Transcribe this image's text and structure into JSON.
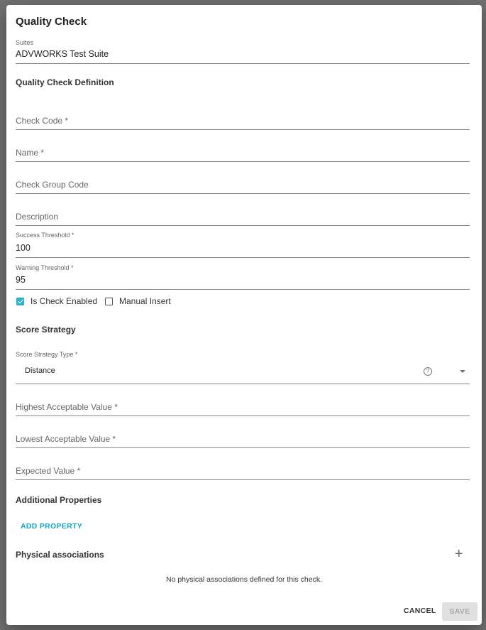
{
  "dialog": {
    "title": "Quality Check",
    "suites": {
      "label": "Suites",
      "value": "ADVWORKS Test Suite"
    },
    "definition": {
      "heading": "Quality Check Definition",
      "check_code": {
        "placeholder": "Check Code *",
        "value": ""
      },
      "name": {
        "placeholder": "Name *",
        "value": ""
      },
      "check_group_code": {
        "placeholder": "Check Group Code",
        "value": ""
      },
      "description": {
        "placeholder": "Description",
        "value": ""
      },
      "success_threshold": {
        "label": "Success Threshold *",
        "value": "100"
      },
      "warning_threshold": {
        "label": "Warning Threshold *",
        "value": "95"
      },
      "is_check_enabled": {
        "label": "Is Check Enabled",
        "checked": true
      },
      "manual_insert": {
        "label": "Manual Insert",
        "checked": false
      }
    },
    "score_strategy": {
      "heading": "Score Strategy",
      "type": {
        "label": "Score Strategy Type *",
        "value": "Distance",
        "help_icon": "help-circle-icon",
        "dropdown_icon": "caret-down-icon"
      },
      "highest_acceptable": {
        "placeholder": "Highest Acceptable Value *",
        "value": ""
      },
      "lowest_acceptable": {
        "placeholder": "Lowest Acceptable Value *",
        "value": ""
      },
      "expected": {
        "placeholder": "Expected Value *",
        "value": ""
      }
    },
    "additional_properties": {
      "heading": "Additional Properties",
      "add_label": "ADD PROPERTY"
    },
    "physical_associations": {
      "heading": "Physical associations",
      "add_icon": "plus-icon",
      "empty_text": "No physical associations defined for this check."
    },
    "actions": {
      "cancel": "CANCEL",
      "save": "SAVE"
    },
    "colors": {
      "accent": "#13a7c4",
      "checkbox": "#26b3cf",
      "overlay": "#707070"
    }
  }
}
